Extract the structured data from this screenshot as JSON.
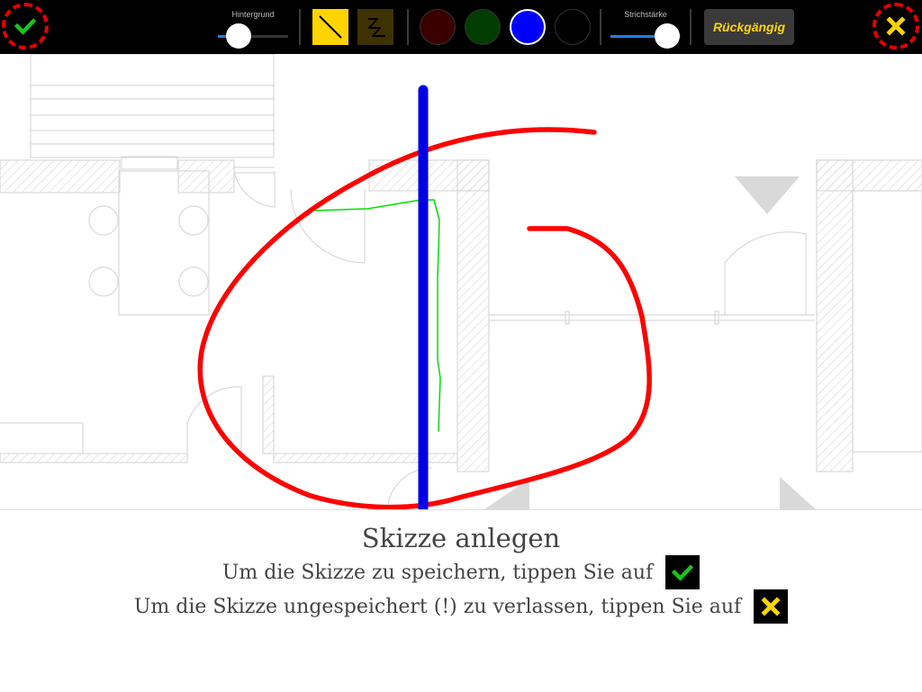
{
  "toolbar": {
    "confirm_icon": "checkmark-icon",
    "cancel_icon": "x-icon",
    "background_slider": {
      "label": "Hintergrund",
      "value": 0.27
    },
    "mode_straight_icon": "straight-line-icon",
    "mode_freehand_icon": "freehand-line-icon",
    "colors": [
      "#3a0000",
      "#013d01",
      "#0000ff",
      "#000000"
    ],
    "selected_color": "#0000ff",
    "stroke_slider": {
      "label": "Strichstärke",
      "value": 0.82
    },
    "undo_label": "Rückgängig",
    "accent": "#ffd400",
    "danger": "#e60000"
  },
  "instructions": {
    "title": "Skizze anlegen",
    "save_text": "Um die Skizze zu speichern, tippen Sie auf",
    "leave_text": "Um die Skizze ungespeichert (!) zu verlassen, tippen Sie auf"
  },
  "sketch_colors": {
    "red": "#ff0000",
    "green": "#00e000",
    "blue": "#0000e6"
  }
}
